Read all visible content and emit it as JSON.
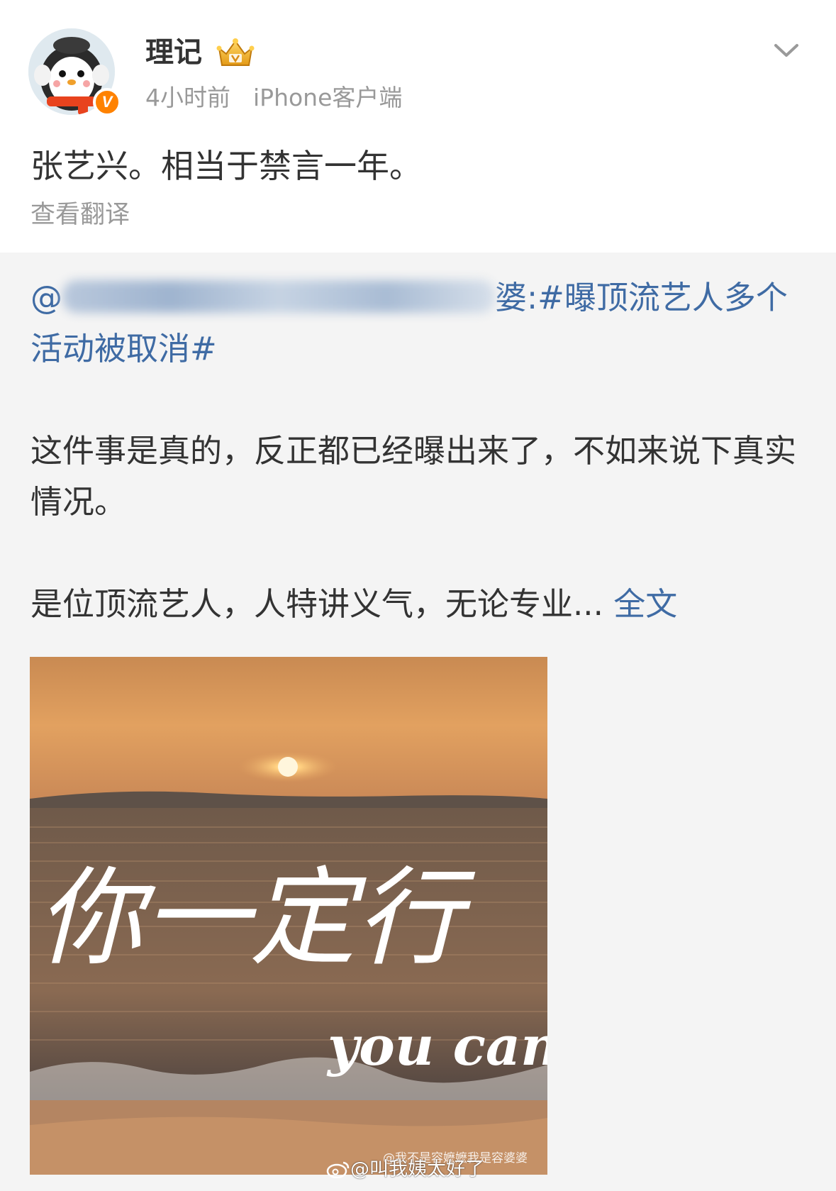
{
  "author": {
    "name": "理记",
    "time": "4小时前",
    "source": "iPhone客户端",
    "avatar_icon": "penguin-avatar",
    "verified_icon": "verified-v-badge",
    "verified_label": "V",
    "vip_icon": "vip-crown-icon"
  },
  "post": {
    "text": "张艺兴。相当于禁言一年。",
    "translate_label": "查看翻译"
  },
  "repost": {
    "mention_prefix": "@",
    "mention_tail": "婆",
    "hashtag": ":#曝顶流艺人多个活动被取消#",
    "paragraph1": "这件事是真的，反正都已经曝出来了，不如来说下真实情况。",
    "paragraph2": "是位顶流艺人，人特讲义气，无论专业...",
    "expand_label": "全文",
    "image": {
      "calligraphy": "你一定行",
      "subtitle": "you can",
      "watermark_small": "@我不是容嬷嬷我是容婆婆",
      "watermark": "@叫我姨太好了"
    }
  },
  "colors": {
    "link": "#3f6ba4",
    "text": "#333333",
    "meta": "#999999",
    "badge": "#ff8200"
  }
}
